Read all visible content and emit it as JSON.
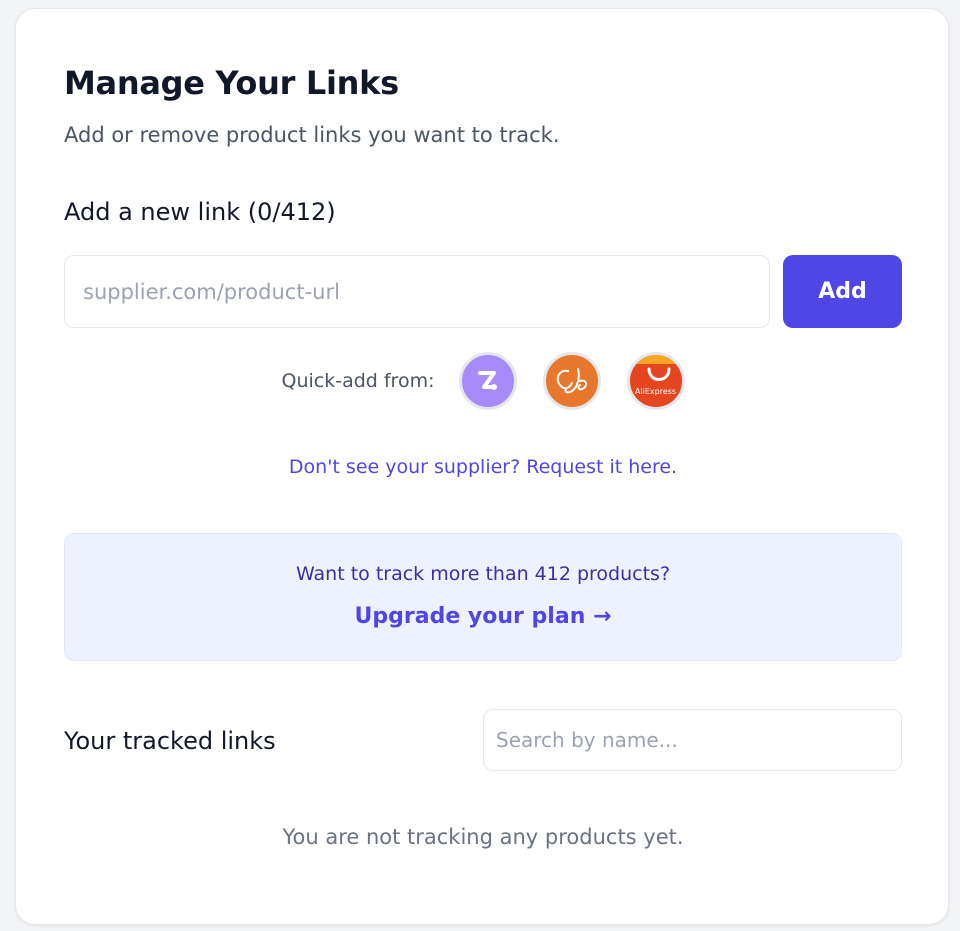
{
  "header": {
    "title": "Manage Your Links",
    "subtitle": "Add or remove product links you want to track."
  },
  "add_link": {
    "heading": "Add a new link (0/412)",
    "input_placeholder": "supplier.com/product-url",
    "input_value": "",
    "add_button_label": "Add"
  },
  "quick_add": {
    "label": "Quick-add from:",
    "suppliers": [
      {
        "name": "zendrop",
        "icon": "zendrop-logo-icon"
      },
      {
        "name": "cj",
        "icon": "cj-dropshipping-logo-icon"
      },
      {
        "name": "aliexpress",
        "icon": "aliexpress-logo-icon",
        "logo_text": "AliExpress"
      }
    ]
  },
  "request_link": "Don't see your supplier? Request it here.",
  "upgrade": {
    "question": "Want to track more than 412 products?",
    "link_label": "Upgrade your plan →"
  },
  "tracked": {
    "heading": "Your tracked links",
    "search_placeholder": "Search by name...",
    "empty_message": "You are not tracking any products yet."
  },
  "colors": {
    "accent": "#4f46e5",
    "upgrade_bg": "#eef2ff",
    "zendrop": "#a78bfa",
    "cj": "#e8772e",
    "aliexpress": "#e6461f"
  }
}
